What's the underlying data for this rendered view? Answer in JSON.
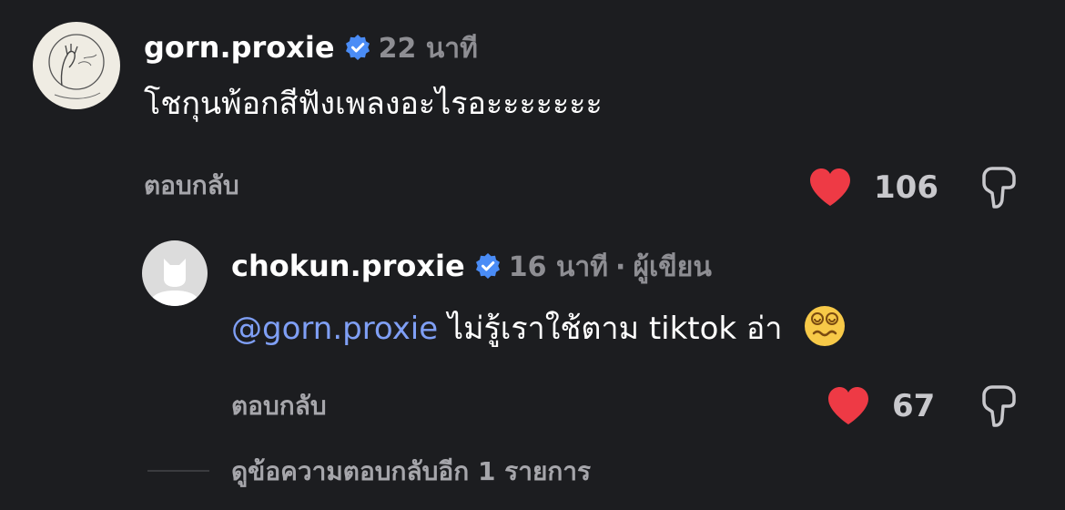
{
  "comments": [
    {
      "username": "gorn.proxie",
      "time": "22 นาที",
      "text": "โชกุนพ้อกสีฟังเพลงอะไรอะะะะะะะ",
      "reply_label": "ตอบกลับ",
      "likes": "106",
      "avatar": "sketch-avatar"
    },
    {
      "username": "chokun.proxie",
      "time": "16 นาที",
      "separator": "·",
      "author_badge": "ผู้เขียน",
      "mention": "@gorn.proxie",
      "text": " ไม่รู้เราใช้ตาม tiktok อ่า",
      "emoji": "dizzy-face-emoji",
      "reply_label": "ตอบกลับ",
      "likes": "67",
      "avatar": "default-cat-avatar"
    }
  ],
  "view_more_replies": "ดูข้อความตอบกลับอีก 1 รายการ",
  "colors": {
    "background": "#1c1d20",
    "verified": "#4a8cf6",
    "heart": "#ee3a45",
    "mention": "#7f9ff5",
    "muted": "#8e8e93"
  }
}
